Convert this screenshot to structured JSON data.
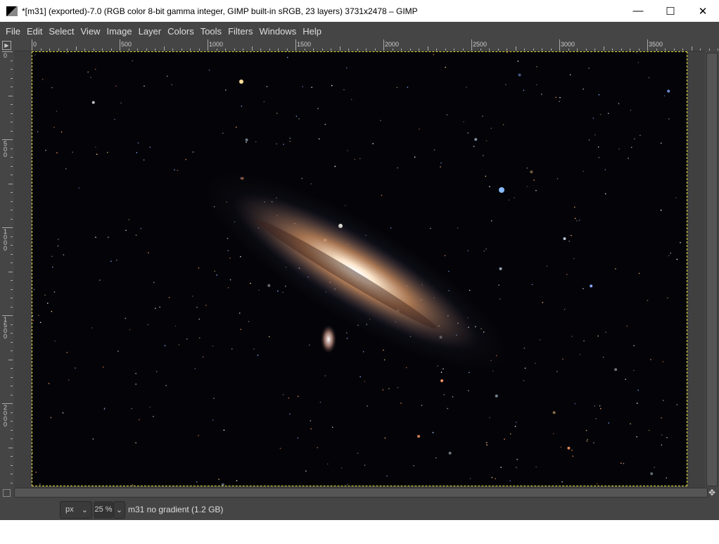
{
  "window": {
    "title": "*[m31] (exported)-7.0 (RGB color 8-bit gamma integer, GIMP built-in sRGB, 23 layers) 3731x2478 – GIMP",
    "minimize": "—",
    "maximize": "☐",
    "close": "✕"
  },
  "menu": [
    "File",
    "Edit",
    "Select",
    "View",
    "Image",
    "Layer",
    "Colors",
    "Tools",
    "Filters",
    "Windows",
    "Help"
  ],
  "hruler": [
    "0",
    "500",
    "1000",
    "1500",
    "2000",
    "2500",
    "3000",
    "3500"
  ],
  "vruler": [
    "0",
    "500",
    "1000",
    "1500",
    "2000"
  ],
  "status": {
    "unit": "px",
    "zoom": "25 %",
    "info": "m31 no gradient (1.2 GB)"
  }
}
